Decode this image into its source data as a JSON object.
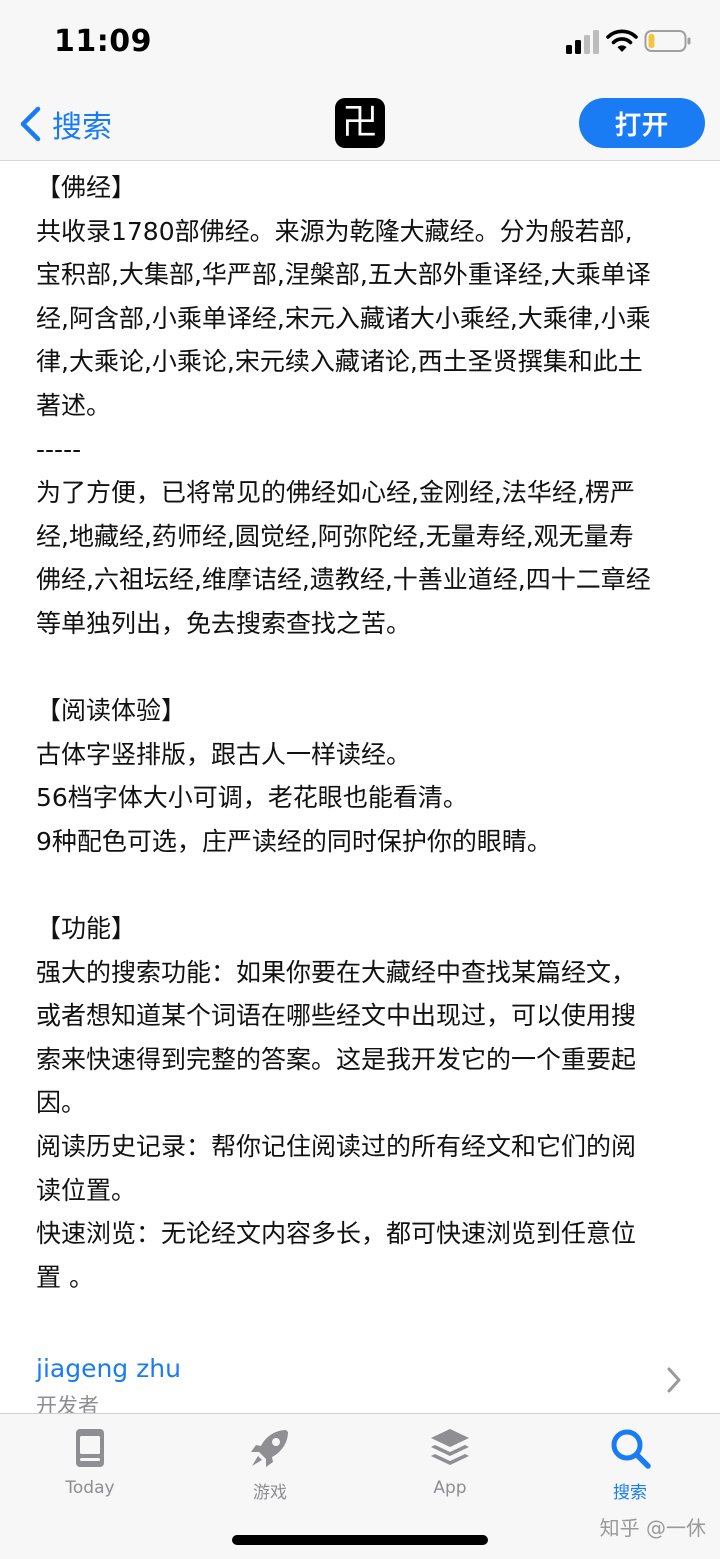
{
  "status_bar": {
    "time": "11:09"
  },
  "nav": {
    "back_label": "搜索",
    "app_glyph": "卍",
    "open_label": "打开"
  },
  "description": [
    "【佛经】",
    "共收录1780部佛经。来源为乾隆大藏经。分为般若部,",
    "宝积部,大集部,华严部,涅槃部,五大部外重译经,大乘单译",
    "经,阿含部,小乘单译经,宋元入藏诸大小乘经,大乘律,小乘",
    "律,大乘论,小乘论,宋元续入藏诸论,西土圣贤撰集和此土",
    "著述。",
    "-----",
    "为了方便，已将常见的佛经如心经,金刚经,法华经,楞严",
    "经,地藏经,药师经,圆觉经,阿弥陀经,无量寿经,观无量寿",
    "佛经,六祖坛经,维摩诘经,遗教经,十善业道经,四十二章经",
    "等单独列出，免去搜索查找之苦。",
    "",
    "【阅读体验】",
    "古体字竖排版，跟古人一样读经。",
    "56档字体大小可调，老花眼也能看清。",
    "9种配色可选，庄严读经的同时保护你的眼睛。",
    "",
    "【功能】",
    "强大的搜索功能：如果你要在大藏经中查找某篇经文，",
    "或者想知道某个词语在哪些经文中出现过，可以使用搜",
    "索来快速得到完整的答案。这是我开发它的一个重要起",
    "因。",
    "阅读历史记录：帮你记住阅读过的所有经文和它们的阅",
    "读位置。",
    "快速浏览：无论经文内容多长，都可快速浏览到任意位",
    "置 。"
  ],
  "developer": {
    "name": "jiageng zhu",
    "label": "开发者"
  },
  "tabs": [
    {
      "label": "Today",
      "icon": "today-icon"
    },
    {
      "label": "游戏",
      "icon": "rocket-icon"
    },
    {
      "label": "App",
      "icon": "layers-icon"
    },
    {
      "label": "搜索",
      "icon": "search-icon",
      "active": true
    }
  ],
  "watermark": "知乎 @一休",
  "colors": {
    "accent": "#1a7cf5",
    "inactive": "#8e8e93",
    "battery_low": "#f5c542"
  }
}
